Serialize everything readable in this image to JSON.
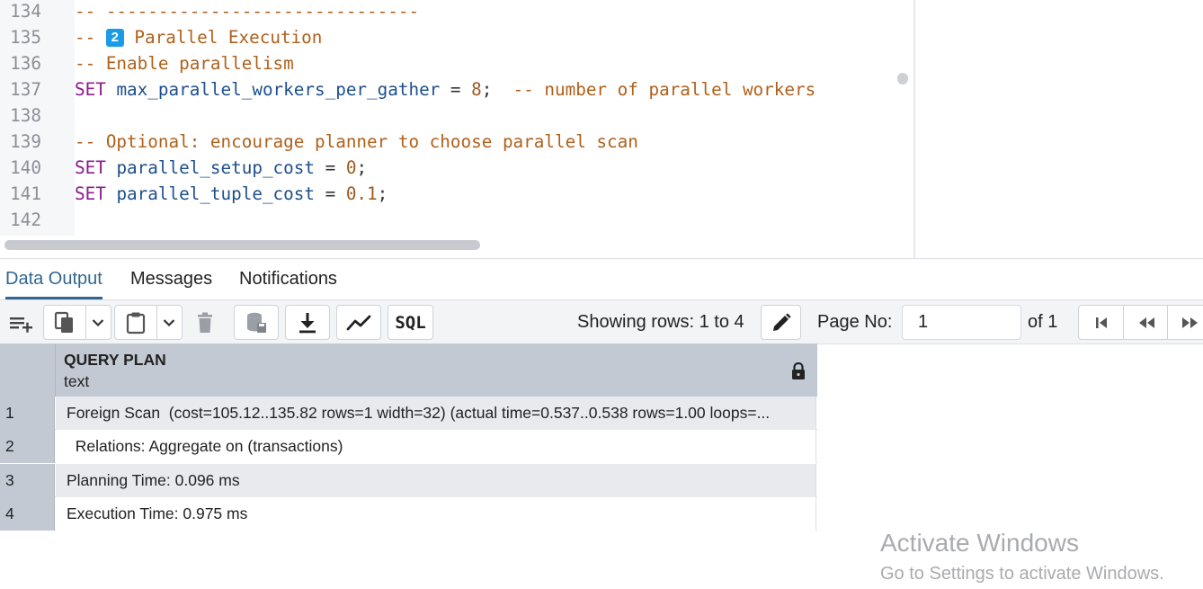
{
  "editor": {
    "lines": [
      {
        "num": "134",
        "tokens": [
          {
            "t": "comment",
            "v": "-- ------------------------------"
          }
        ]
      },
      {
        "num": "135",
        "tokens": [
          {
            "t": "comment",
            "v": "-- "
          },
          {
            "t": "badge",
            "v": "2"
          },
          {
            "t": "comment",
            "v": " Parallel Execution"
          }
        ]
      },
      {
        "num": "136",
        "tokens": [
          {
            "t": "comment",
            "v": "-- Enable parallelism"
          }
        ]
      },
      {
        "num": "137",
        "tokens": [
          {
            "t": "kw",
            "v": "SET"
          },
          {
            "t": "op",
            "v": " "
          },
          {
            "t": "id",
            "v": "max_parallel_workers_per_gather"
          },
          {
            "t": "op",
            "v": " = "
          },
          {
            "t": "num",
            "v": "8"
          },
          {
            "t": "op",
            "v": ";  "
          },
          {
            "t": "comment",
            "v": "-- number of parallel workers"
          }
        ]
      },
      {
        "num": "138",
        "tokens": []
      },
      {
        "num": "139",
        "tokens": [
          {
            "t": "comment",
            "v": "-- Optional: encourage planner to choose parallel scan"
          }
        ]
      },
      {
        "num": "140",
        "tokens": [
          {
            "t": "kw",
            "v": "SET"
          },
          {
            "t": "op",
            "v": " "
          },
          {
            "t": "id",
            "v": "parallel_setup_cost"
          },
          {
            "t": "op",
            "v": " = "
          },
          {
            "t": "num",
            "v": "0"
          },
          {
            "t": "op",
            "v": ";"
          }
        ]
      },
      {
        "num": "141",
        "tokens": [
          {
            "t": "kw",
            "v": "SET"
          },
          {
            "t": "op",
            "v": " "
          },
          {
            "t": "id",
            "v": "parallel_tuple_cost"
          },
          {
            "t": "op",
            "v": " = "
          },
          {
            "t": "num",
            "v": "0.1"
          },
          {
            "t": "op",
            "v": ";"
          }
        ]
      },
      {
        "num": "142",
        "tokens": []
      }
    ]
  },
  "tabs": [
    {
      "label": "Data Output",
      "active": true
    },
    {
      "label": "Messages",
      "active": false
    },
    {
      "label": "Notifications",
      "active": false
    }
  ],
  "toolbar": {
    "icons": [
      "add-row-icon",
      "copy-icon",
      "chevron-down-icon",
      "paste-icon",
      "chevron-down-icon",
      "delete-icon",
      "save-data-icon",
      "download-icon",
      "graph-icon",
      "sql-icon"
    ],
    "sql_label": "SQL",
    "showing_rows": "Showing rows: 1 to 4",
    "page_no_label": "Page No:",
    "page_no_value": "1",
    "page_of": "of 1",
    "nav_icons": [
      "first-page-icon",
      "previous-page-icon",
      "next-page-icon"
    ]
  },
  "grid": {
    "column_title": "QUERY PLAN",
    "column_type": "text",
    "rows": [
      {
        "num": "1",
        "value": "Foreign Scan  (cost=105.12..135.82 rows=1 width=32) (actual time=0.537..0.538 rows=1.00 loops=..."
      },
      {
        "num": "2",
        "value": "  Relations: Aggregate on (transactions)"
      },
      {
        "num": "3",
        "value": "Planning Time: 0.096 ms"
      },
      {
        "num": "4",
        "value": "Execution Time: 0.975 ms"
      }
    ]
  },
  "watermark": {
    "title": "Activate Windows",
    "subtitle": "Go to Settings to activate Windows."
  },
  "colors": {
    "accent": "#326690",
    "keyword": "#8c1c8c",
    "identifier": "#1d4f8c",
    "comment": "#b0601b",
    "number": "#a05a1e",
    "badge": "#1a9be6"
  }
}
